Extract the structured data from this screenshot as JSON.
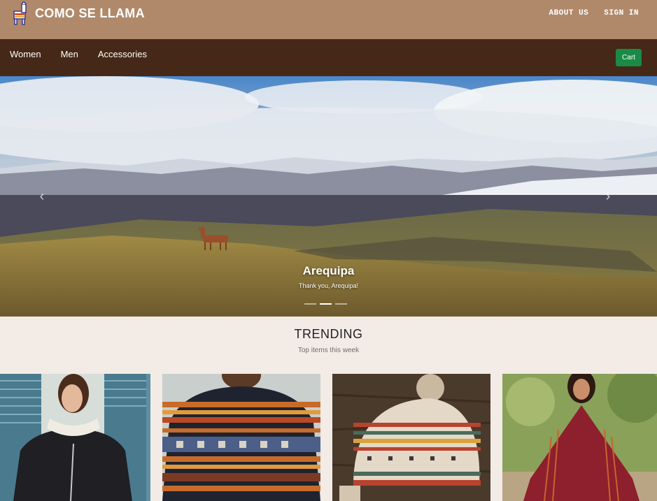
{
  "header": {
    "brand": "COMO SE LLAMA",
    "links": [
      "ABOUT US",
      "SIGN IN"
    ]
  },
  "nav": {
    "items": [
      "Women",
      "Men",
      "Accessories"
    ],
    "cart_label": "Cart"
  },
  "hero": {
    "title": "Arequipa",
    "subtitle": "Thank you, Arequipa!",
    "active_slide": 2,
    "slide_count": 3,
    "prev_icon": "chevron-left-icon",
    "next_icon": "chevron-right-icon"
  },
  "trending": {
    "title": "TRENDING",
    "subtitle": "Top items this week"
  },
  "products": [
    {
      "name": "black-sweater-white-collar"
    },
    {
      "name": "patterned-mens-sweater"
    },
    {
      "name": "knit-pompom-hat"
    },
    {
      "name": "burgundy-poncho"
    }
  ],
  "colors": {
    "topbar": "#b0896a",
    "navbar": "#452817",
    "cart": "#1a8a47",
    "page_bg": "#f3ebe6"
  }
}
